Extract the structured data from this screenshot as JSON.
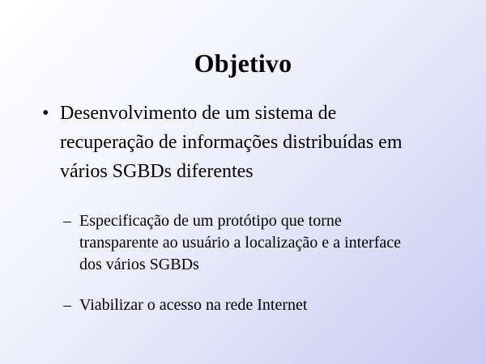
{
  "slide": {
    "title": "Objetivo",
    "bullet_main": {
      "marker": "•",
      "text_lines": [
        "Desenvolvimento de um sistema de",
        "recuperação de informações distribuídas em",
        "vários SGBDs diferentes"
      ]
    },
    "sub_bullets": [
      {
        "marker": "–",
        "text_lines": [
          "Especificação de um protótipo que torne",
          "transparente ao usuário a localização e a interface",
          "dos vários SGBDs"
        ]
      },
      {
        "marker": "–",
        "text_lines": [
          "Viabilizar o acesso na rede Internet"
        ]
      }
    ]
  }
}
